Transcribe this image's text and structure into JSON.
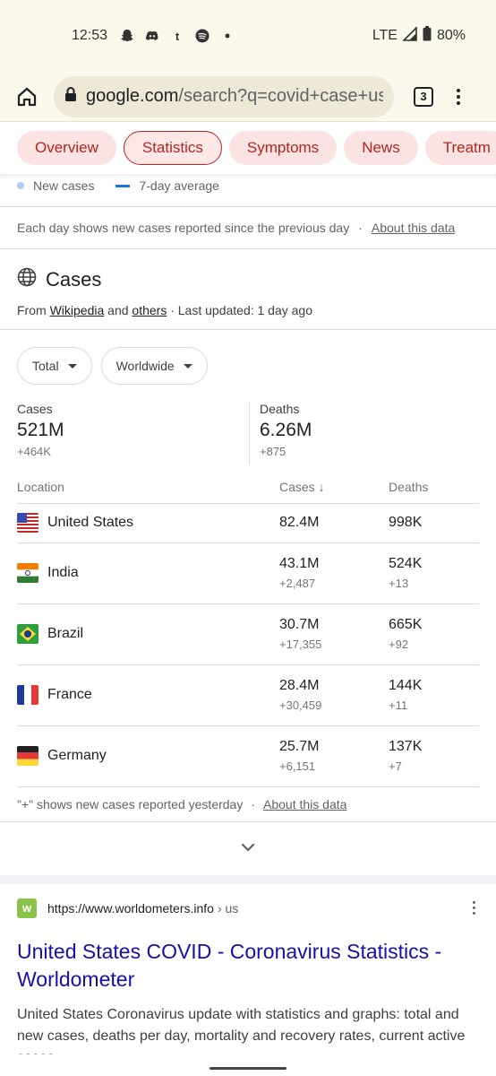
{
  "status_bar": {
    "time": "12:53",
    "network": "LTE",
    "battery": "80%",
    "notification_icons": [
      "snapchat-icon",
      "discord-icon",
      "tumblr-icon",
      "spotify-icon",
      "dot-icon"
    ]
  },
  "browser": {
    "url_host": "google.com",
    "url_path": "/search?q=covid+case+usa",
    "tab_count": "3"
  },
  "chips": [
    "Overview",
    "Statistics",
    "Symptoms",
    "News",
    "Treatm"
  ],
  "active_chip": "Statistics",
  "legend": {
    "new_cases": "New cases",
    "avg": "7-day average"
  },
  "note": {
    "text": "Each day shows new cases reported since the previous day",
    "separator": "·",
    "link": "About this data"
  },
  "cases": {
    "title": "Cases",
    "from": "From",
    "source1": "Wikipedia",
    "and": "and",
    "source2": "others",
    "updated": "· Last updated: 1 day ago"
  },
  "filters": {
    "scope": "Total",
    "region": "Worldwide"
  },
  "stats": {
    "cases_label": "Cases",
    "cases_value": "521M",
    "cases_change": "+464K",
    "deaths_label": "Deaths",
    "deaths_value": "6.26M",
    "deaths_change": "+875"
  },
  "table": {
    "headers": {
      "location": "Location",
      "cases": "Cases",
      "deaths": "Deaths"
    },
    "rows": [
      {
        "country": "United States",
        "flag": "us",
        "cases": "82.4M",
        "cases_new": "",
        "deaths": "998K",
        "deaths_new": ""
      },
      {
        "country": "India",
        "flag": "in",
        "cases": "43.1M",
        "cases_new": "+2,487",
        "deaths": "524K",
        "deaths_new": "+13"
      },
      {
        "country": "Brazil",
        "flag": "br",
        "cases": "30.7M",
        "cases_new": "+17,355",
        "deaths": "665K",
        "deaths_new": "+92"
      },
      {
        "country": "France",
        "flag": "fr",
        "cases": "28.4M",
        "cases_new": "+30,459",
        "deaths": "144K",
        "deaths_new": "+11"
      },
      {
        "country": "Germany",
        "flag": "de",
        "cases": "25.7M",
        "cases_new": "+6,151",
        "deaths": "137K",
        "deaths_new": "+7"
      }
    ]
  },
  "footnote": {
    "text": "\"+\" shows new cases reported yesterday",
    "separator": "·",
    "link": "About this data"
  },
  "result": {
    "favicon_letter": "w",
    "url": "https://www.worldometers.info",
    "crumb": "› us",
    "title": "United States COVID - Coronavirus Statistics - Worldometer",
    "snippet": "United States Coronavirus update with statistics and graphs: total and new cases, deaths per day, mortality and recovery rates, current active cases"
  },
  "colors": {
    "chip_bg": "#fbe3e3",
    "chip_text": "#b3261e",
    "link_title": "#1a0dab",
    "accent_blue": "#1a73e8"
  }
}
